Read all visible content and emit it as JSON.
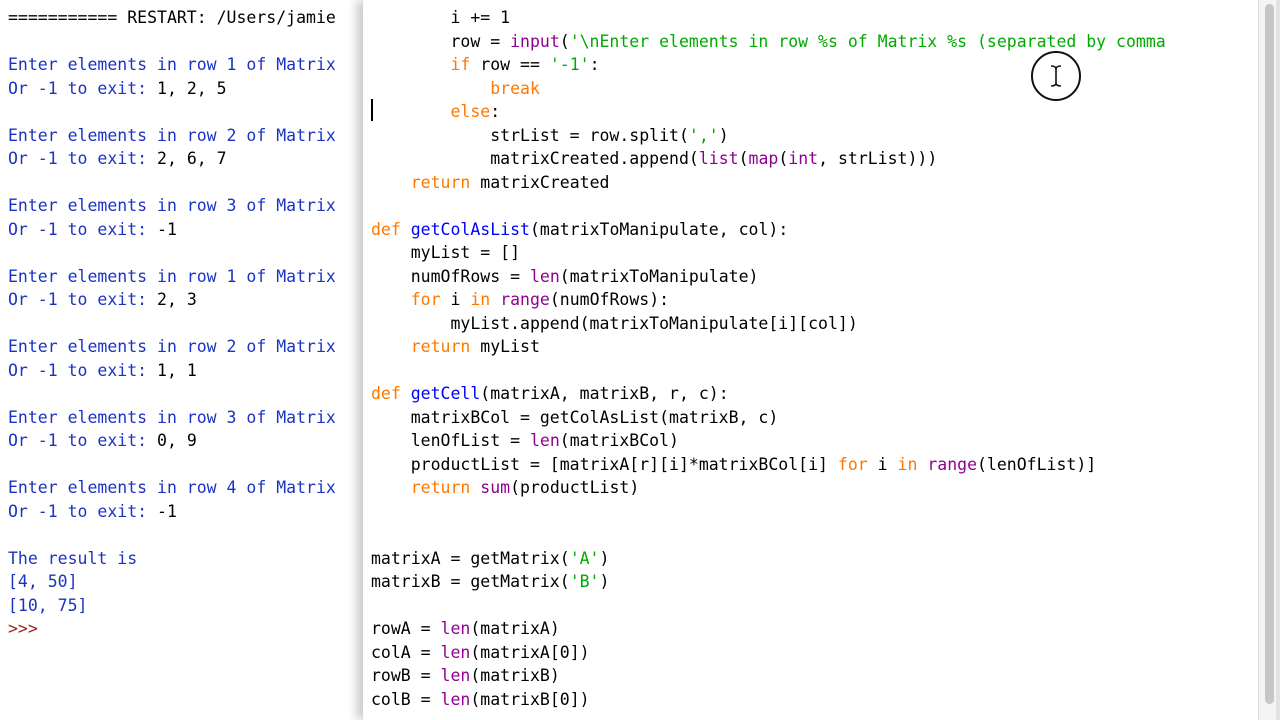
{
  "shell": {
    "lines": [
      {
        "text": "=========== RESTART: /Users/jamie",
        "cls": "c-restart"
      },
      {
        "text": "",
        "cls": "c-stdout"
      },
      {
        "text": "Enter elements in row 1 of Matrix",
        "cls": "c-stdout"
      },
      {
        "text": "Or -1 to exit: ",
        "cls": "c-stdout",
        "input": "1, 2, 5"
      },
      {
        "text": "",
        "cls": "c-stdout"
      },
      {
        "text": "Enter elements in row 2 of Matrix",
        "cls": "c-stdout"
      },
      {
        "text": "Or -1 to exit: ",
        "cls": "c-stdout",
        "input": "2, 6, 7"
      },
      {
        "text": "",
        "cls": "c-stdout"
      },
      {
        "text": "Enter elements in row 3 of Matrix",
        "cls": "c-stdout"
      },
      {
        "text": "Or -1 to exit: ",
        "cls": "c-stdout",
        "input": "-1"
      },
      {
        "text": "",
        "cls": "c-stdout"
      },
      {
        "text": "Enter elements in row 1 of Matrix",
        "cls": "c-stdout"
      },
      {
        "text": "Or -1 to exit: ",
        "cls": "c-stdout",
        "input": "2, 3"
      },
      {
        "text": "",
        "cls": "c-stdout"
      },
      {
        "text": "Enter elements in row 2 of Matrix",
        "cls": "c-stdout"
      },
      {
        "text": "Or -1 to exit: ",
        "cls": "c-stdout",
        "input": "1, 1"
      },
      {
        "text": "",
        "cls": "c-stdout"
      },
      {
        "text": "Enter elements in row 3 of Matrix",
        "cls": "c-stdout"
      },
      {
        "text": "Or -1 to exit: ",
        "cls": "c-stdout",
        "input": "0, 9"
      },
      {
        "text": "",
        "cls": "c-stdout"
      },
      {
        "text": "Enter elements in row 4 of Matrix",
        "cls": "c-stdout"
      },
      {
        "text": "Or -1 to exit: ",
        "cls": "c-stdout",
        "input": "-1"
      },
      {
        "text": "",
        "cls": "c-stdout"
      },
      {
        "text": "The result is",
        "cls": "c-stdout"
      },
      {
        "text": "[4, 50]",
        "cls": "c-stdout"
      },
      {
        "text": "[10, 75]",
        "cls": "c-stdout"
      },
      {
        "text": ">>> ",
        "cls": "c-prompt"
      }
    ]
  },
  "editor": {
    "lines": [
      [
        [
          "        i += 1",
          ""
        ]
      ],
      [
        [
          "        row = ",
          ""
        ],
        [
          "input",
          "bi"
        ],
        [
          "(",
          ""
        ],
        [
          "'\\nEnter elements in row %s of Matrix %s (separated by comma",
          "str"
        ]
      ],
      [
        [
          "        ",
          ""
        ],
        [
          "if",
          "kw"
        ],
        [
          " row == ",
          ""
        ],
        [
          "'-1'",
          "str"
        ],
        [
          ":",
          ""
        ]
      ],
      [
        [
          "            ",
          ""
        ],
        [
          "break",
          "kw"
        ]
      ],
      [
        [
          "        ",
          ""
        ],
        [
          "else",
          "kw"
        ],
        [
          ":",
          ""
        ]
      ],
      [
        [
          "            strList = row.split(",
          ""
        ],
        [
          "','",
          "str"
        ],
        [
          ")",
          ""
        ]
      ],
      [
        [
          "            matrixCreated.append(",
          ""
        ],
        [
          "list",
          "bi"
        ],
        [
          "(",
          ""
        ],
        [
          "map",
          "bi"
        ],
        [
          "(",
          ""
        ],
        [
          "int",
          "bi"
        ],
        [
          ", strList)))",
          ""
        ]
      ],
      [
        [
          "    ",
          ""
        ],
        [
          "return",
          "kw"
        ],
        [
          " matrixCreated",
          ""
        ]
      ],
      [
        [
          "",
          ""
        ]
      ],
      [
        [
          "def",
          "kw"
        ],
        [
          " ",
          ""
        ],
        [
          "getColAsList",
          "def"
        ],
        [
          "(matrixToManipulate, col):",
          ""
        ]
      ],
      [
        [
          "    myList = []",
          ""
        ]
      ],
      [
        [
          "    numOfRows = ",
          ""
        ],
        [
          "len",
          "bi"
        ],
        [
          "(matrixToManipulate)",
          ""
        ]
      ],
      [
        [
          "    ",
          ""
        ],
        [
          "for",
          "kw"
        ],
        [
          " i ",
          ""
        ],
        [
          "in",
          "kw"
        ],
        [
          " ",
          ""
        ],
        [
          "range",
          "bi"
        ],
        [
          "(numOfRows):",
          ""
        ]
      ],
      [
        [
          "        myList.append(matrixToManipulate[i][col])",
          ""
        ]
      ],
      [
        [
          "    ",
          ""
        ],
        [
          "return",
          "kw"
        ],
        [
          " myList",
          ""
        ]
      ],
      [
        [
          "",
          ""
        ]
      ],
      [
        [
          "def",
          "kw"
        ],
        [
          " ",
          ""
        ],
        [
          "getCell",
          "def"
        ],
        [
          "(matrixA, matrixB, r, c):",
          ""
        ]
      ],
      [
        [
          "    matrixBCol = getColAsList(matrixB, c)",
          ""
        ]
      ],
      [
        [
          "    lenOfList = ",
          ""
        ],
        [
          "len",
          "bi"
        ],
        [
          "(matrixBCol)",
          ""
        ]
      ],
      [
        [
          "    productList = [matrixA[r][i]*matrixBCol[i] ",
          ""
        ],
        [
          "for",
          "kw"
        ],
        [
          " i ",
          ""
        ],
        [
          "in",
          "kw"
        ],
        [
          " ",
          ""
        ],
        [
          "range",
          "bi"
        ],
        [
          "(lenOfList)]",
          ""
        ]
      ],
      [
        [
          "    ",
          ""
        ],
        [
          "return",
          "kw"
        ],
        [
          " ",
          ""
        ],
        [
          "sum",
          "bi"
        ],
        [
          "(productList)",
          ""
        ]
      ],
      [
        [
          "",
          ""
        ]
      ],
      [
        [
          "",
          ""
        ]
      ],
      [
        [
          "matrixA = getMatrix(",
          ""
        ],
        [
          "'A'",
          "str"
        ],
        [
          ")",
          ""
        ]
      ],
      [
        [
          "matrixB = getMatrix(",
          ""
        ],
        [
          "'B'",
          "str"
        ],
        [
          ")",
          ""
        ]
      ],
      [
        [
          "",
          ""
        ]
      ],
      [
        [
          "rowA = ",
          ""
        ],
        [
          "len",
          "bi"
        ],
        [
          "(matrixA)",
          ""
        ]
      ],
      [
        [
          "colA = ",
          ""
        ],
        [
          "len",
          "bi"
        ],
        [
          "(matrixA[0])",
          ""
        ]
      ],
      [
        [
          "rowB = ",
          ""
        ],
        [
          "len",
          "bi"
        ],
        [
          "(matrixB)",
          ""
        ]
      ],
      [
        [
          "colB = ",
          ""
        ],
        [
          "len",
          "bi"
        ],
        [
          "(matrixB[0])",
          ""
        ]
      ]
    ]
  }
}
